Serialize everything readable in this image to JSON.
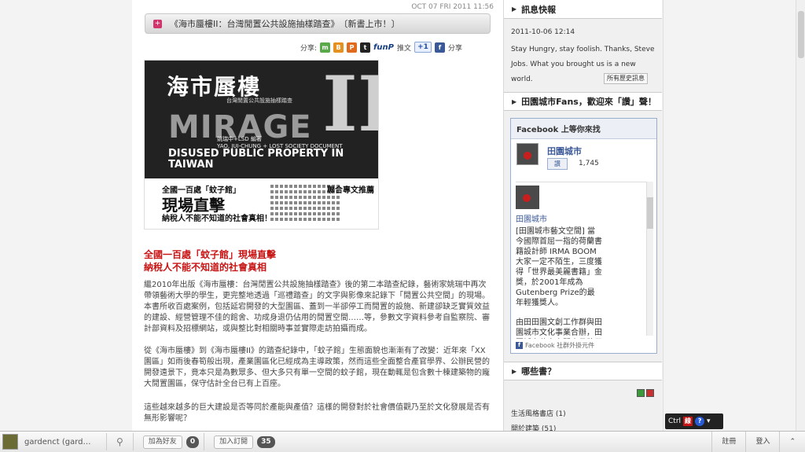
{
  "post": {
    "date": "OCT 07 FRI 2011 11:56",
    "title_marker": "+",
    "title": "《海市蜃樓II：台灣閒置公共設施抽樣踏查》　〔新書上市！〕",
    "share_label": "分享:",
    "share_icons": [
      "m",
      "B",
      "P",
      "t"
    ],
    "funp_label": "funP",
    "funp_suffix": "推文",
    "plus1_label": "+1",
    "fb_share_label": "分享"
  },
  "cover": {
    "title": "海市蜃樓",
    "subtitle": "台灣閒置公共設施抽樣踏查",
    "mirage": "MIRAGE",
    "two": "II",
    "authors": "姚瑞中+LSD 編著",
    "authors_en": "YAO, JUI-CHUNG + LOST SOCIETY DOCUMENT",
    "english_title": "DISUSED PUBLIC PROPERTY IN TAIWAN",
    "band1": "全國一百處「蚊子館」",
    "band2": "現場直擊",
    "band3": "納稅人不能不知道的社會真相！",
    "recommend": "聯合專文推薦"
  },
  "content": {
    "headline1": "全國一百處「蚊子館」現場直擊",
    "headline2": "納稅人不能不知道的社會真相",
    "p1": "繼2010年出版《海市蜃樓：台灣閒置公共設施抽樣踏查》後的第二本踏查紀錄，藝術家姚瑞中再次帶領藝術大學的學生，更完整地透過「巡禮踏查」的文字與影像來記錄下「閒置公共空間」的現場。本書所收百處案例，包括延宕開發的大型園區、蓋到一半卻停工而閒置的設施、新建卻缺乏實質效益的建設、經營管理不佳的館舍、功成身退仍佔用的閒置空間……等，參數文字資料參考自監察院、審計部資料及招標網站，或與整比對相關時事並實際走訪拍攝而成。",
    "p2": "從《海市蜃樓》到《海市蜃樓II》的踏查紀錄中，「蚊子館」生態面貌也漸漸有了改變：近年來「XX園區」如雨後春筍般出現，產業園區化已經成為主導政策，然而這些全面整合產官學界、公辦民營的開發遠景下，竟本只是為數眾多、但大多只有單一空間的蚊子館，現在動輒是包含數十棟建築物的龐大閒置園區，保守估計全台已有上百座。",
    "p3": "這些越來越多的巨大建設是否等同於產能與產值？這樣的開發對於社會價值觀乃至於文化發展是否有無形影響呢？"
  },
  "sidebar": {
    "news_title": "訊息快報",
    "news_date": "2011-10-06 12:14",
    "news_text": "Stay Hungry, stay foolish. Thanks, Steve Jobs. What you brought us is a new world.",
    "history_btn": "所有歷史訊息",
    "fans_title": "田園城市Fans，歡迎來「讚」聲！",
    "fb_head": "Facebook 上等你來找",
    "fb_page_name": "田園城市",
    "fb_like": "讚",
    "fb_count": "1,745",
    "fb_stream_name": "田園城市",
    "fb_stream_text1": "[田園城市藝文空間] 當今國際首屈一指的荷蘭書籍設計師 IRMA BOOM大家一定不陌生，三度獲得「世界最美麗書籍」金獎，於2001年成為Gutenberg Prize的最年輕獲獎人。",
    "fb_stream_text2": "由田田園文創工作群與田園城市文化事業合辦，田園城市藝文空間十月將展出這位做「書本之外思考」",
    "fb_footer": "Facebook 社群外掛元件",
    "books_title": "哪些書？",
    "list1": "生活風格書店 (1)",
    "list2": "開於建築 (51)"
  },
  "bottombar": {
    "user": "gardenct (gard…",
    "add_friend": "加為好友",
    "friend_count": "0",
    "subscribe": "加入訂閱",
    "sub_count": "35",
    "notice": "註冊",
    "login": "登入"
  },
  "toolfloat": {
    "label": "Ctrl"
  },
  "colors": {
    "accent_red": "#c81414",
    "fb_blue": "#3b5998",
    "title_pink": "#d0346a"
  }
}
